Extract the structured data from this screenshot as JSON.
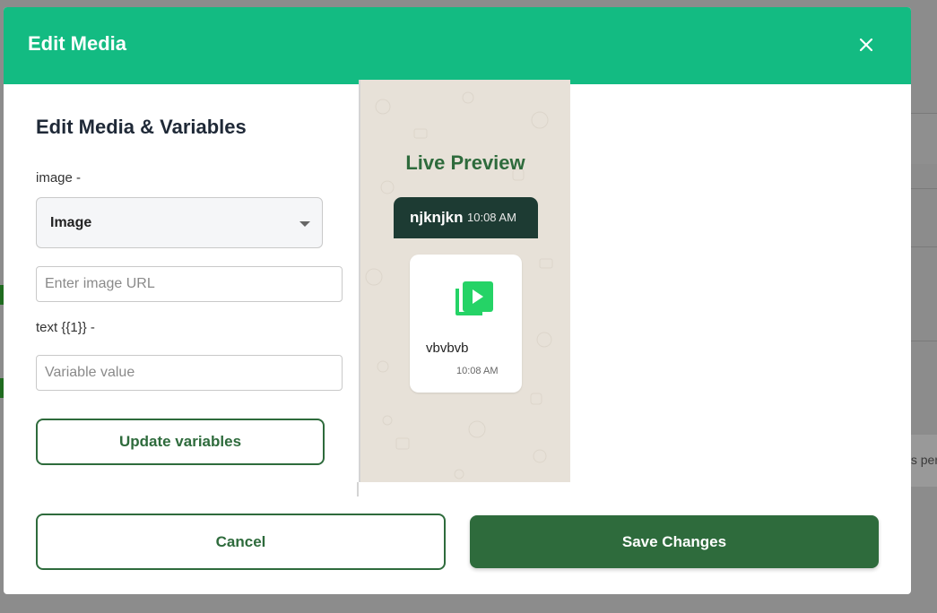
{
  "modal": {
    "title": "Edit Media"
  },
  "form": {
    "section_title": "Edit Media & Variables",
    "image_label": "image -",
    "media_type": "Image",
    "image_url_placeholder": "Enter image URL",
    "text_label": "text {{1}} -",
    "variable_placeholder": "Variable value",
    "update_label": "Update variables"
  },
  "preview": {
    "title": "Live Preview",
    "header_name": "njknjkn",
    "header_time": "10:08 AM",
    "message_text": "vbvbvb",
    "message_time": "10:08 AM"
  },
  "footer": {
    "cancel_label": "Cancel",
    "save_label": "Save Changes"
  },
  "background": {
    "partial_text": "s per"
  },
  "colors": {
    "header": "#13bb82",
    "primary": "#2e6b3c",
    "chat_header": "#1d3b33",
    "media_icon": "#25d366"
  }
}
